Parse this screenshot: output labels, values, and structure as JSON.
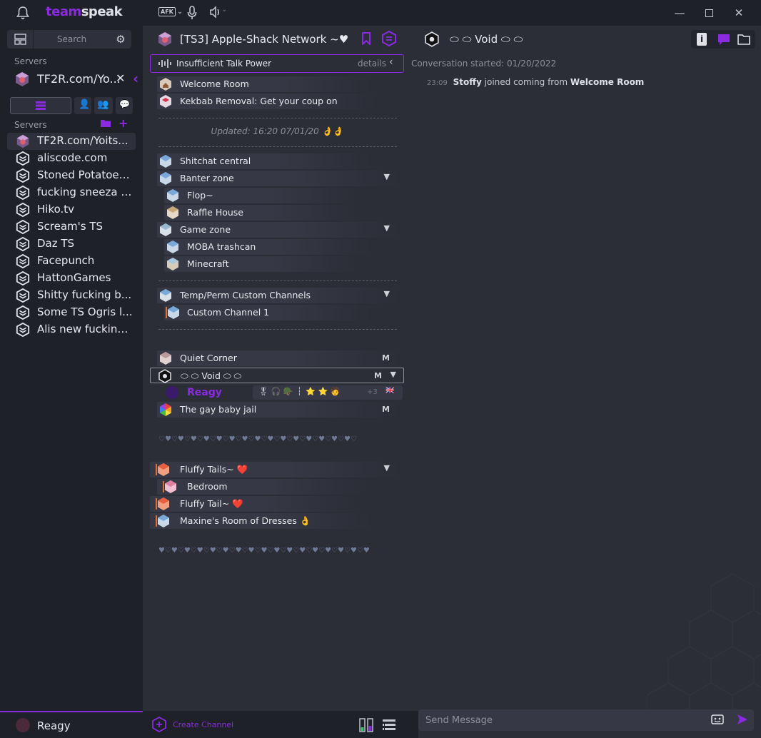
{
  "app": {
    "logo_part1": "team",
    "logo_part2": "speak",
    "afk_label": "AFK"
  },
  "colors": {
    "accent": "#8a2be2",
    "bg_dark": "#1f2129",
    "bg_panel": "#2b2d37",
    "row": "#363945"
  },
  "sidebar": {
    "search_placeholder": "Search",
    "active_label": "Servers",
    "active_server": "TF2R.com/Yo...",
    "list_label": "Servers",
    "servers": [
      "TF2R.com/Yoits...",
      "aliscode.com",
      "Stoned Potatoes...",
      "fucking sneeza a...",
      "Hiko.tv",
      "Scream's TS",
      "Daz TS",
      "Facepunch",
      "HattonGames",
      "Shitty fucking b...",
      "Some TS Ogris l...",
      "Alis new fucking..."
    ]
  },
  "tree": {
    "server_title": "[TS3] Apple-Shack Network ~♥",
    "banner_text": "Insufficient Talk Power",
    "banner_details": "details",
    "updated": "Updated: 16:20 07/01/20 👌👌",
    "hearts": "♡♥♡♥♡♥♡♥♡♥♡♥♡♥♡♥♡♥♡♥♡♥♡♥♡♥♡♥♡♥♡",
    "hearts2": "♥♡♥♡♥♡♥♡♥♡♥♡♥♡♥♡♥♡♥♡♥♡♥♡♥♡♥♡♥♡♥♡♥",
    "channels": {
      "welcome": "Welcome Room",
      "kebab": "Kekbab Removal: Get your coup on",
      "shitchat": "Shitchat central",
      "banter": "Banter zone",
      "flop": "Flop~",
      "raffle": "Raffle House",
      "game": "Game zone",
      "moba": "MOBA trashcan",
      "minecraft": "Minecraft",
      "temp": "Temp/Perm Custom Channels",
      "custom1": "Custom Channel 1",
      "quiet": "Quiet Corner",
      "void": "⬭ ⬭ Void ⬭ ⬭",
      "gaybaby": "The gay baby jail",
      "fluffy": "Fluffy Tails~ ❤️",
      "bedroom": "Bedroom",
      "fluffy2": "Fluffy Tail~ ❤️",
      "maxine": "Maxine's Room of Dresses 👌"
    },
    "m_flag": "M",
    "user": {
      "name": "Reagy",
      "badges": "🎖 🎧 🪖   ┆  ⭐ ⭐ 🧑",
      "more": "+3",
      "flag": "🇬🇧"
    }
  },
  "chat": {
    "title": "⬭ ⬭ Void ⬭ ⬭",
    "conversation_started": "Conversation started: 01/20/2022",
    "message": {
      "time": "23:09",
      "user": "Stoffy",
      "text": "joined coming from",
      "channel": "Welcome Room"
    },
    "input_placeholder": "Send Message"
  },
  "bottom": {
    "me": "Reagy",
    "create_channel": "Create Channel"
  }
}
